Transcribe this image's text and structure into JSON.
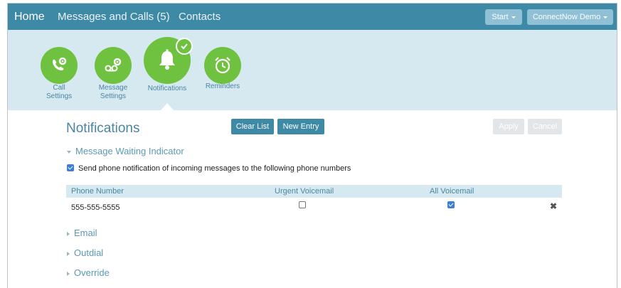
{
  "nav": {
    "home": "Home",
    "messages_calls": "Messages and Calls (5)",
    "contacts": "Contacts",
    "start": "Start",
    "account": "ConnectNow Demo"
  },
  "settings_nav": [
    {
      "label_line1": "Call",
      "label_line2": "Settings",
      "icon": "phone-gear-icon"
    },
    {
      "label_line1": "Message",
      "label_line2": "Settings",
      "icon": "voicemail-gear-icon"
    },
    {
      "label_line1": "Notifications",
      "label_line2": "",
      "icon": "bell-icon",
      "active": true
    },
    {
      "label_line1": "Reminders",
      "label_line2": "",
      "icon": "alarm-clock-icon"
    }
  ],
  "page": {
    "title": "Notifications",
    "clear_list": "Clear List",
    "new_entry": "New Entry",
    "apply": "Apply",
    "cancel": "Cancel"
  },
  "mwi": {
    "heading": "Message Waiting Indicator",
    "checkbox_label": "Send phone notification of incoming messages to the following phone numbers",
    "checkbox_checked": true,
    "table": {
      "headers": [
        "Phone Number",
        "Urgent Voicemail",
        "All Voicemail"
      ],
      "rows": [
        {
          "phone": "555-555-5555",
          "urgent": false,
          "all": true
        }
      ]
    }
  },
  "sections": [
    "Email",
    "Outdial",
    "Override"
  ],
  "colors": {
    "topbar": "#3e8aa6",
    "band": "#d6e9f1",
    "accent_green": "#6fc23f",
    "link_blue": "#4a86a0"
  }
}
